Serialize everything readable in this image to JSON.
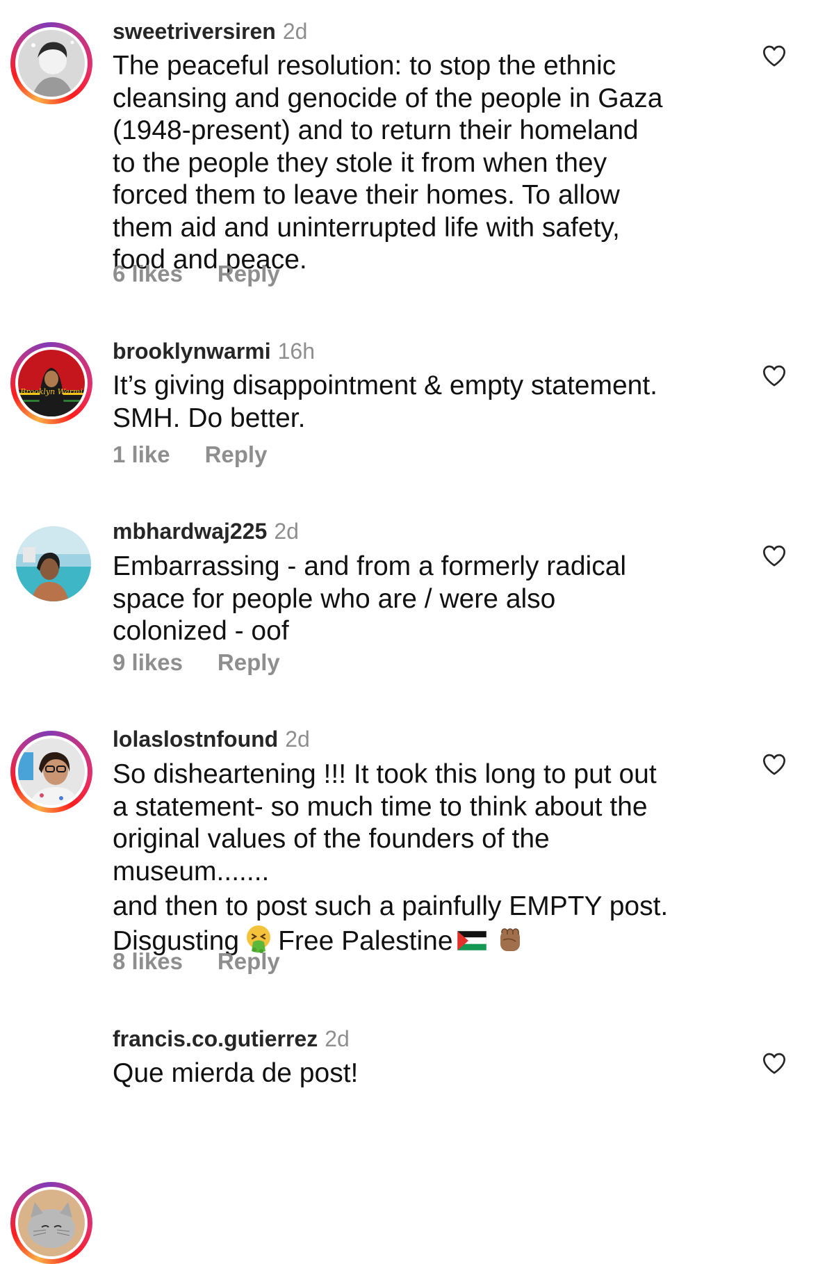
{
  "comments": [
    {
      "username": "sweetriversiren",
      "time": "2d",
      "text": "The peaceful resolution: to stop the ethnic\ncleansing and genocide of the people in Gaza\n(1948-present) and to return their homeland\nto the people they stole it from when they\nforced them to leave their homes. To allow\nthem aid and uninterrupted life with safety,\nfood and peace.",
      "likes": "6 likes",
      "reply": "Reply"
    },
    {
      "username": "brooklynwarmi",
      "time": "16h",
      "text": "It’s giving disappointment & empty statement.\nSMH. Do better.",
      "likes": "1 like",
      "reply": "Reply",
      "avatar_label": "Brooklyn Warmi"
    },
    {
      "username": "mbhardwaj225",
      "time": "2d",
      "text": "Embarrassing - and from a formerly radical\nspace for people who are / were also\ncolonized - oof",
      "likes": "9 likes",
      "reply": "Reply"
    },
    {
      "username": "lolaslostnfound",
      "time": "2d",
      "text": "So disheartening !!! It took this long to put out\na statement- so much time to think about the\noriginal values of the founders of the\nmuseum.......",
      "text2_a": "and then to post such a painfully EMPTY post.",
      "text2_b": "Disgusting",
      "text2_c": "Free Palestine",
      "likes": "8 likes",
      "reply": "Reply"
    },
    {
      "username": "francis.co.gutierrez",
      "time": "2d",
      "text": "Que mierda de post!"
    }
  ],
  "icons": {
    "like": "heart-outline-icon",
    "vomit": "face-vomiting-emoji",
    "flag": "palestine-flag-emoji",
    "fist": "raised-fist-emoji"
  },
  "colors": {
    "text": "#111111",
    "secondary": "#8e8e8e",
    "story_ring_start": "#fcaf45",
    "story_ring_end": "#c13584"
  }
}
